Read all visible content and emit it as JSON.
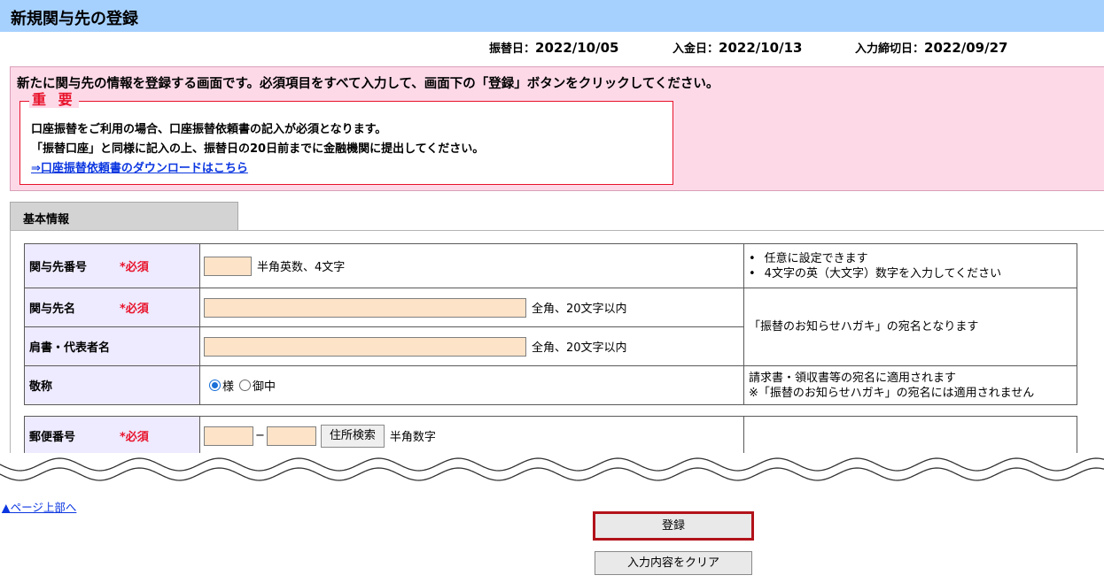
{
  "page": {
    "title": "新規関与先の登録"
  },
  "dates": {
    "transfer_label": "振替日：",
    "transfer_value": "2022/10/05",
    "deposit_label": "入金日：",
    "deposit_value": "2022/10/13",
    "deadline_label": "入力締切日：",
    "deadline_value": "2022/09/27"
  },
  "notice": {
    "intro": "新たに関与先の情報を登録する画面です。必須項目をすべて入力して、画面下の「登録」ボタンをクリックしてください。",
    "important_title": "重 要",
    "line1": "口座振替をご利用の場合、口座振替依頼書の記入が必須となります。",
    "line2": "「振替口座」と同様に記入の上、振替日の20日前までに金融機関に提出してください。",
    "download_link": "⇒口座振替依頼書のダウンロードはこちら"
  },
  "section": {
    "tab_label": "基本情報"
  },
  "form": {
    "required_mark": "*必須",
    "client_code": {
      "label": "関与先番号",
      "value": "",
      "hint": "半角英数、4文字",
      "note1": "任意に設定できます",
      "note2": "4文字の英（大文字）数字を入力してください"
    },
    "client_name": {
      "label": "関与先名",
      "value": "",
      "hint": "全角、20文字以内"
    },
    "representative": {
      "label": "肩書・代表者名",
      "value": "",
      "hint": "全角、20文字以内"
    },
    "name_note": "「振替のお知らせハガキ」の宛名となります",
    "honorific": {
      "label": "敬称",
      "options": [
        "様",
        "御中"
      ],
      "selected": "様",
      "note1": "請求書・領収書等の宛名に適用されます",
      "note2": "※「振替のお知らせハガキ」の宛名には適用されません"
    },
    "postal": {
      "label": "郵便番号",
      "value1": "",
      "value2": "",
      "dash": "−",
      "search_button": "住所検索",
      "hint": "半角数字"
    }
  },
  "footer": {
    "top_link": "▲ページ上部へ",
    "register_button": "登録",
    "clear_button": "入力内容をクリア"
  },
  "colors": {
    "title_bar": "#a6d1ff",
    "notice_bg": "#fdd9e8",
    "required_red": "#e8122a",
    "input_bg": "#fde3c8",
    "label_bg": "#eeeaff",
    "link_blue": "#0b36e0",
    "register_border": "#b2121a"
  }
}
